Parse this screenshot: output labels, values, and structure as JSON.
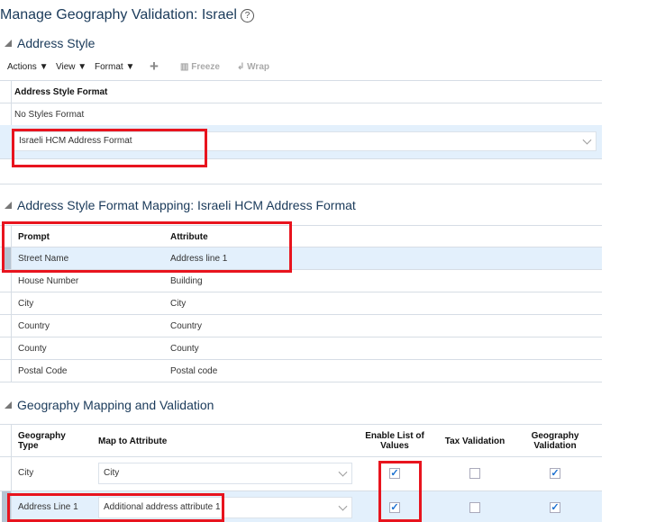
{
  "page_title": "Manage Geography Validation: Israel",
  "address_style": {
    "heading": "Address Style",
    "toolbar": {
      "actions": "Actions",
      "view": "View",
      "format": "Format",
      "freeze": "Freeze",
      "wrap": "Wrap"
    },
    "column": "Address Style Format",
    "rows": [
      "No Styles Format"
    ],
    "selected_value": "Israeli HCM Address Format"
  },
  "mapping": {
    "heading": "Address Style Format Mapping: Israeli HCM Address Format",
    "columns": [
      "Prompt",
      "Attribute"
    ],
    "rows": [
      [
        "Street Name",
        "Address line 1"
      ],
      [
        "House Number",
        "Building"
      ],
      [
        "City",
        "City"
      ],
      [
        "Country",
        "Country"
      ],
      [
        "County",
        "County"
      ],
      [
        "Postal Code",
        "Postal code"
      ]
    ]
  },
  "geo": {
    "heading": "Geography Mapping and Validation",
    "columns": [
      "Geography Type",
      "Map to Attribute",
      "Enable List of Values",
      "Tax Validation",
      "Geography Validation"
    ],
    "rows": [
      {
        "type": "City",
        "attribute": "City",
        "lov": true,
        "tax": false,
        "geo": true
      },
      {
        "type": "Address Line 1",
        "attribute": "Additional address attribute 1",
        "lov": true,
        "tax": false,
        "geo": true
      }
    ]
  },
  "colors": {
    "highlight": "#e8141e",
    "selected_row": "#e3f0fc"
  }
}
